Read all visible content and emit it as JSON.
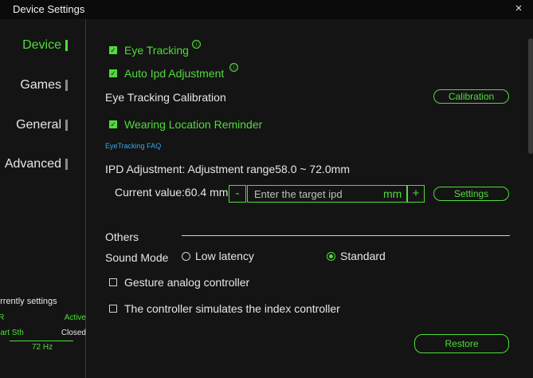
{
  "window": {
    "title": "Device Settings",
    "close_icon": "×"
  },
  "sidebar": {
    "items": [
      {
        "label": "Device",
        "active": true
      },
      {
        "label": "Games",
        "active": false
      },
      {
        "label": "General",
        "active": false
      },
      {
        "label": "Advanced",
        "active": false
      }
    ]
  },
  "status": {
    "heading": "urrently settings",
    "rows": [
      {
        "key": "FR",
        "value": "Active"
      },
      {
        "key": "mart Sth",
        "value": "Closed"
      }
    ],
    "refresh_rate": "72 Hz"
  },
  "device": {
    "eye_tracking": {
      "label": "Eye Tracking",
      "checked": true,
      "info_icon": "ⓘ"
    },
    "auto_ipd": {
      "label": "Auto Ipd Adjustment",
      "checked": true,
      "info_icon": "ⓘ"
    },
    "calibration": {
      "label": "Eye Tracking Calibration",
      "button": "Calibration"
    },
    "wearing_reminder": {
      "label": "Wearing Location Reminder",
      "checked": true
    },
    "faq_link": "EyeTracking FAQ",
    "ipd": {
      "heading": "IPD Adjustment: Adjustment range58.0 ~ 72.0mm",
      "current_label": "Current value:60.4 mm",
      "minus": "-",
      "placeholder": "Enter the target ipd",
      "unit": "mm",
      "plus": "+",
      "settings_button": "Settings"
    },
    "others": {
      "heading": "Others",
      "sound_mode_label": "Sound Mode",
      "sound_options": [
        {
          "label": "Low latency",
          "selected": false
        },
        {
          "label": "Standard",
          "selected": true
        }
      ],
      "gesture_controller": {
        "label": "Gesture analog controller",
        "checked": false
      },
      "index_controller": {
        "label": "The controller simulates the index controller",
        "checked": false
      }
    },
    "restore_button": "Restore"
  },
  "colors": {
    "accent": "#4fdc3a",
    "background": "#141414",
    "titlebar": "#0b0b0b",
    "link": "#3aa5e6"
  }
}
